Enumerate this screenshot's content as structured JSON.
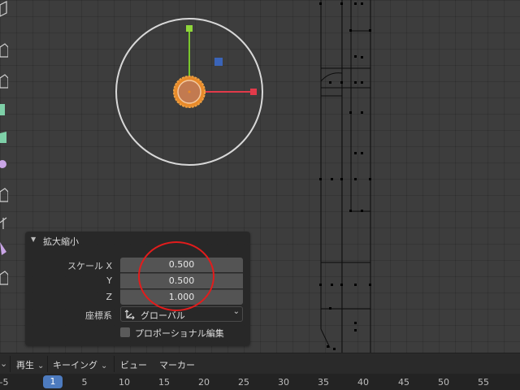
{
  "operator_panel": {
    "title": "拡大縮小",
    "scale_x_label": "スケール X",
    "scale_y_label": "Y",
    "scale_z_label": "Z",
    "scale_x": "0.500",
    "scale_y": "0.500",
    "scale_z": "1.000",
    "orientation_label": "座標系",
    "orientation_value": "グローバル",
    "proportional_label": "プロポーショナル編集",
    "proportional_checked": false
  },
  "timeline": {
    "playback_label": "再生",
    "keying_label": "キーイング",
    "view_label": "ビュー",
    "marker_label": "マーカー",
    "current_frame": "1",
    "ticks": [
      "-5",
      "5",
      "10",
      "15",
      "20",
      "25",
      "30",
      "35",
      "40",
      "45",
      "50",
      "55"
    ]
  },
  "colors": {
    "gizmo_x": "#e23a4a",
    "gizmo_y": "#7ac62c",
    "gizmo_z_plane": "#3a64b8",
    "object_orange": "#e88a2a",
    "annotation_red": "#e21c1c",
    "current_frame_blue": "#4d7bbf"
  }
}
